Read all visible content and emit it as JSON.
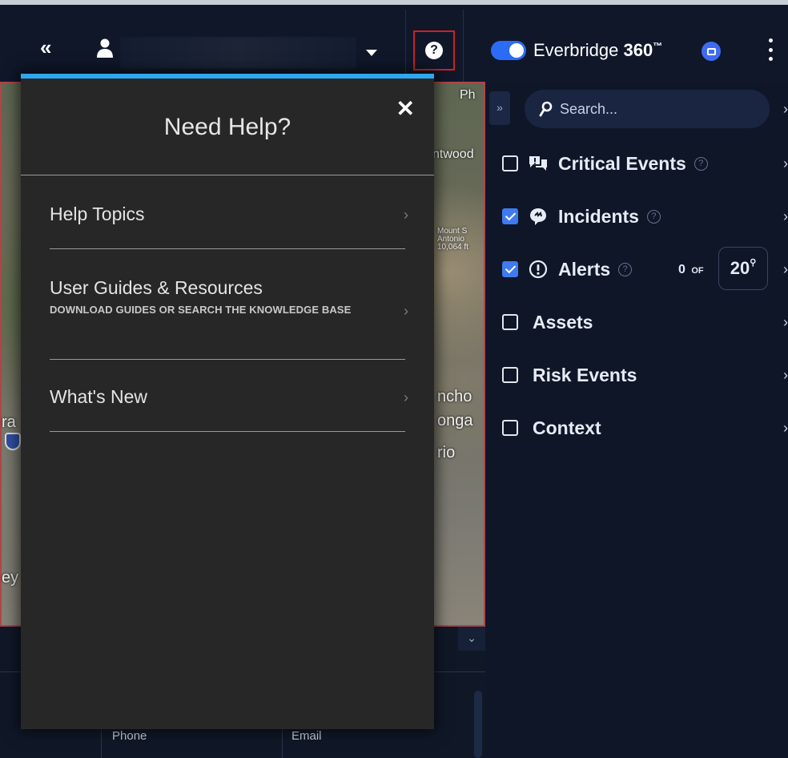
{
  "topbar": {
    "collapse_glyph": "«",
    "help_icon_glyph": "?",
    "brand_prefix": "Everbridge ",
    "brand_bold": "360",
    "brand_tm": "™"
  },
  "map": {
    "labels": [
      "Ph",
      "ntwood",
      "Mount S",
      "Antonio",
      "10,064 ft",
      "ncho",
      "onga",
      "rio",
      "ra",
      "ey"
    ],
    "shield": "10"
  },
  "below_map": {
    "col_phone": "Phone",
    "col_email": "Email"
  },
  "help_panel": {
    "title": "Need Help?",
    "close_glyph": "✕",
    "items": [
      {
        "label": "Help Topics",
        "sub": ""
      },
      {
        "label": "User Guides & Resources",
        "sub": "DOWNLOAD GUIDES OR SEARCH THE KNOWLEDGE BASE"
      },
      {
        "label": "What's New",
        "sub": ""
      }
    ],
    "chevron": "›"
  },
  "right_panel": {
    "expand_glyph": "»",
    "search_placeholder": "Search...",
    "chevron": "›",
    "layers": [
      {
        "label": "Critical Events",
        "checked": false,
        "icon": "chat-bubbles-icon",
        "help": true
      },
      {
        "label": "Incidents",
        "checked": true,
        "icon": "incident-icon",
        "help": true
      },
      {
        "label": "Alerts",
        "checked": true,
        "icon": "alert-icon",
        "help": true
      },
      {
        "label": "Assets",
        "checked": false,
        "icon": "",
        "help": false
      },
      {
        "label": "Risk Events",
        "checked": false,
        "icon": "",
        "help": false
      },
      {
        "label": "Context",
        "checked": false,
        "icon": "",
        "help": false
      }
    ],
    "alerts_count": "0",
    "alerts_of": "OF",
    "alerts_max": "20",
    "help_glyph": "?"
  },
  "colors": {
    "accent_blue": "#2b6cf6",
    "panel_top_bar": "#2ea6f0",
    "help_highlight": "#d11f26"
  }
}
